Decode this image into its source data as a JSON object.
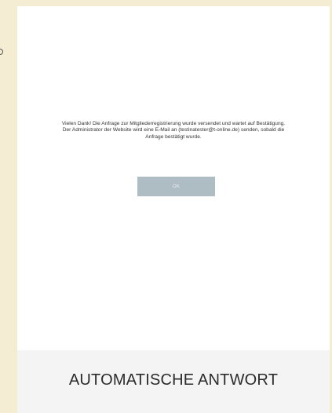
{
  "dialog": {
    "message_line1": "Vielen Dank! Die Anfrage zur Mitgliederregistrierung wurde versendet und wartet auf Bestätigung.",
    "message_line2": "Der Administrator der Website wird eine E-Mail an (testinatester@t-online.de) senden, sobald die",
    "message_line3": "Anfrage bestätigt wurde.",
    "ok_label": "OK"
  },
  "footer": {
    "title": "AUTOMATISCHE ANTWORT"
  },
  "colors": {
    "page_background": "#f4edd3",
    "dialog_background": "#ffffff",
    "button_background": "#aebcc3",
    "footer_background": "#f4f4f4"
  }
}
